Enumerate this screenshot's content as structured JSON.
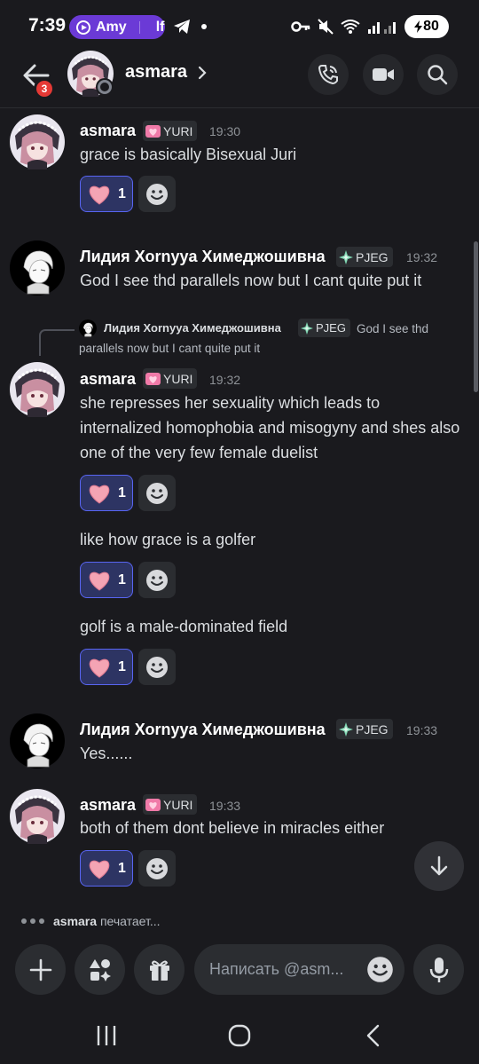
{
  "status_bar": {
    "time": "7:39",
    "pill_user": "Amy",
    "pill_extra": "lf",
    "battery": "80"
  },
  "header": {
    "back_badge": "3",
    "channel_name": "asmara"
  },
  "tags": {
    "yuri": "YURI",
    "pjeg": "PJEG"
  },
  "messages": [
    {
      "author": "asmara",
      "tag": "YURI",
      "time": "19:30",
      "lines": [
        {
          "text": "grace is basically Bisexual Juri",
          "reaction_count": "1"
        }
      ]
    },
    {
      "author": "Лидия Хоrnyya Химеджошивна",
      "tag": "PJEG",
      "time": "19:32",
      "lines": [
        {
          "text": "God I see thd parallels now but I cant quite put it"
        }
      ]
    },
    {
      "reply": {
        "author": "Лидия Хоrnyya Химеджошивна",
        "tag": "PJEG",
        "text": "God I see thd parallels now but I cant quite put it"
      },
      "author": "asmara",
      "tag": "YURI",
      "time": "19:32",
      "lines": [
        {
          "text": "she represses her sexuality which leads to internalized homophobia and misogyny and shes also one of the very few female duelist",
          "reaction_count": "1"
        },
        {
          "text": "like how grace is a golfer",
          "reaction_count": "1"
        },
        {
          "text": "golf is a male-dominated field",
          "reaction_count": "1"
        }
      ]
    },
    {
      "author": "Лидия Хоrnyya Химеджошивна",
      "tag": "PJEG",
      "time": "19:33",
      "lines": [
        {
          "text": "Yes......"
        }
      ]
    },
    {
      "author": "asmara",
      "tag": "YURI",
      "time": "19:33",
      "lines": [
        {
          "text": "both of them dont believe in miracles either",
          "reaction_count": "1"
        }
      ]
    }
  ],
  "typing": {
    "user": "asmara",
    "text": "печатает..."
  },
  "composer": {
    "placeholder": "Написать @asm..."
  },
  "colors": {
    "background": "#1a1a1e",
    "reaction_active": "#5865f2",
    "badge": "#e53935",
    "pill": "#6b3ad6"
  },
  "icons": [
    "back-arrow-icon",
    "phone-call-icon",
    "video-camera-icon",
    "search-icon",
    "heart-emoji",
    "add-reaction-icon",
    "scroll-down-icon",
    "plus-icon",
    "apps-icon",
    "gift-icon",
    "emoji-icon",
    "microphone-icon"
  ]
}
